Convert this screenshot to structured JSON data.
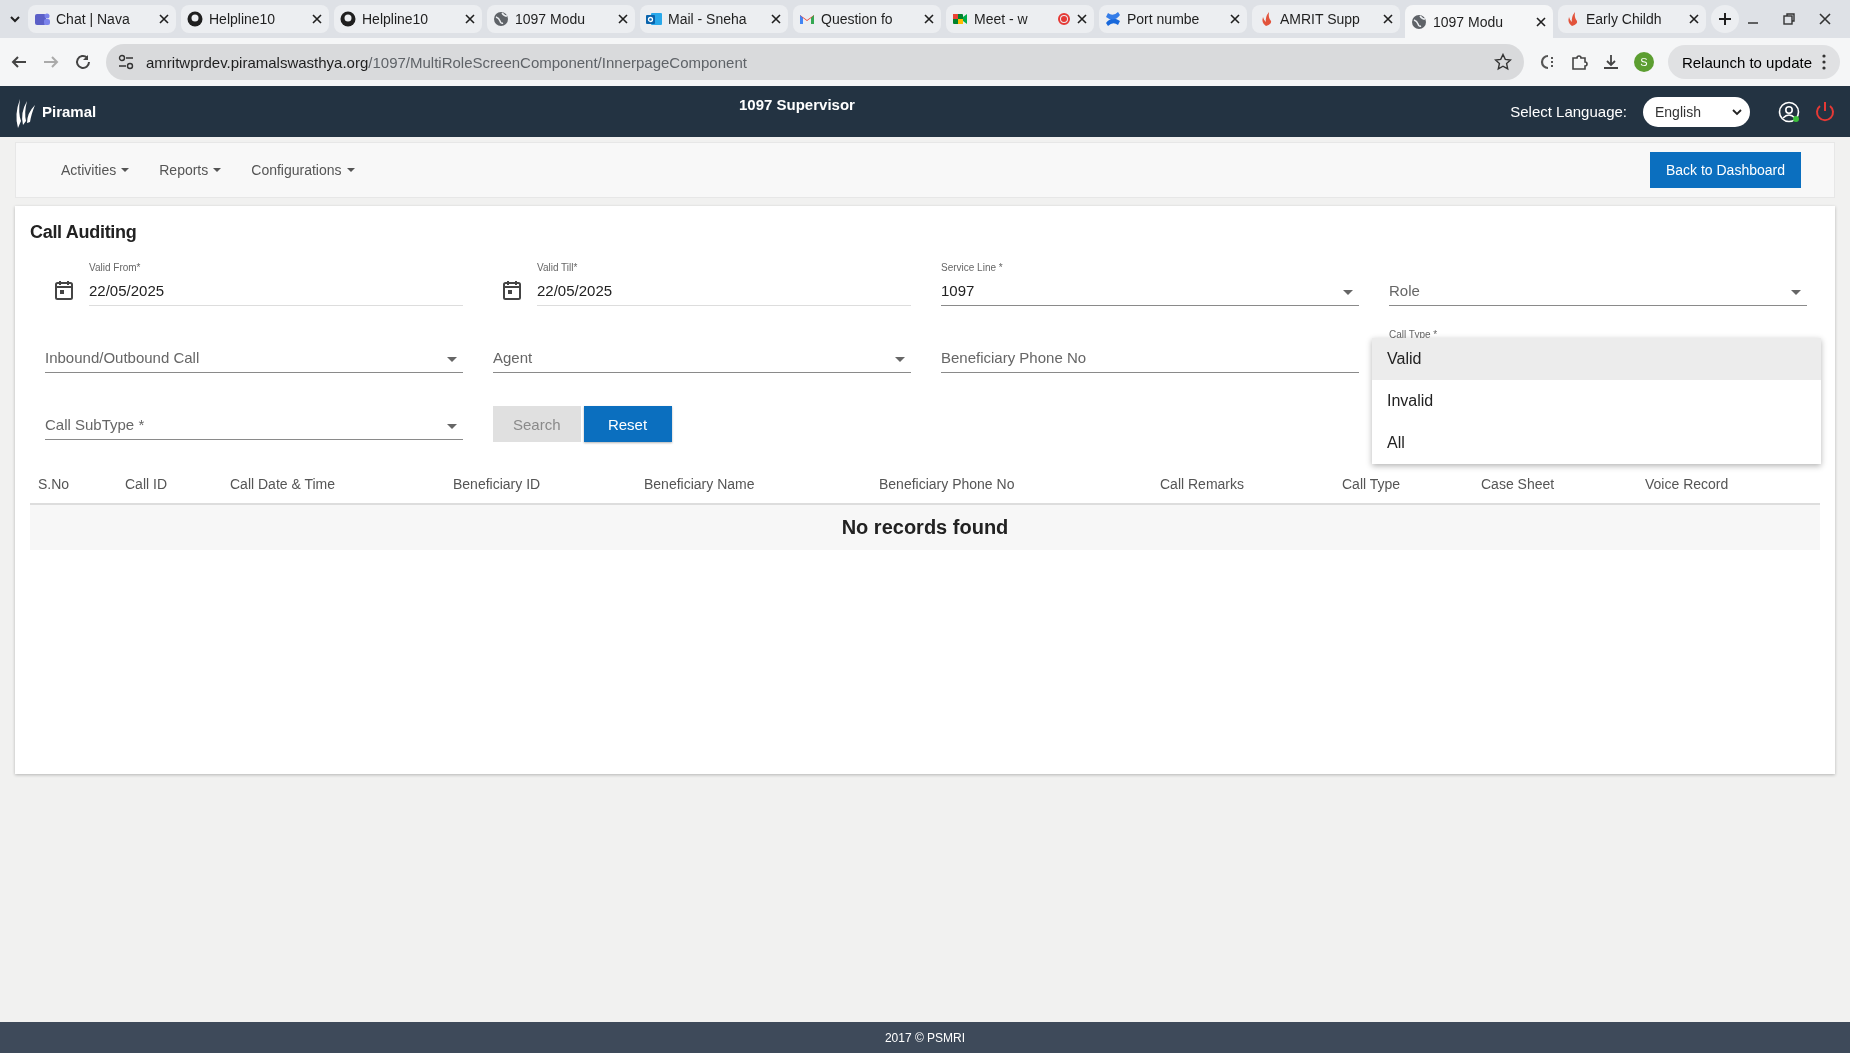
{
  "browser": {
    "tabs": [
      {
        "kind": "teams",
        "title": "Chat | Nava",
        "selected": false,
        "recording": false
      },
      {
        "kind": "github",
        "title": "Helpline10",
        "selected": false,
        "recording": false
      },
      {
        "kind": "github",
        "title": "Helpline10",
        "selected": false,
        "recording": false
      },
      {
        "kind": "globe",
        "title": "1097 Modu",
        "selected": false,
        "recording": false
      },
      {
        "kind": "outlook",
        "title": "Mail - Sneha",
        "selected": false,
        "recording": false
      },
      {
        "kind": "gmail",
        "title": "Question fo",
        "selected": false,
        "recording": false
      },
      {
        "kind": "meet",
        "title": "Meet - w",
        "selected": false,
        "recording": true
      },
      {
        "kind": "confluence",
        "title": "Port numbe",
        "selected": false,
        "recording": false
      },
      {
        "kind": "flame",
        "title": "AMRIT Supp",
        "selected": false,
        "recording": false
      },
      {
        "kind": "globe",
        "title": "1097 Modu",
        "selected": true,
        "recording": false
      },
      {
        "kind": "flame",
        "title": "Early Childh",
        "selected": false,
        "recording": false
      }
    ],
    "url_host": "amritwprdev.piramalswasthya.org",
    "url_path": "/1097/MultiRoleScreenComponent/InnerpageComponent",
    "profile_initial": "S",
    "relaunch": "Relaunch to update"
  },
  "header": {
    "brand": "Piramal",
    "title": "1097 Supervisor",
    "language_label": "Select Language:",
    "language": "English"
  },
  "nav": {
    "menus": [
      "Activities",
      "Reports",
      "Configurations"
    ],
    "back_button": "Back to Dashboard"
  },
  "card": {
    "title": "Call Auditing",
    "fields": [
      {
        "kind": "date",
        "label": "Valid From*",
        "value": "22/05/2025"
      },
      {
        "kind": "date",
        "label": "Valid Till*",
        "value": "22/05/2025"
      },
      {
        "kind": "select",
        "label": "Service Line *",
        "value": "1097"
      },
      {
        "kind": "select",
        "placeholder": "Role"
      },
      {
        "kind": "select",
        "placeholder": "Inbound/Outbound Call"
      },
      {
        "kind": "select",
        "placeholder": "Agent"
      },
      {
        "kind": "input",
        "placeholder": "Beneficiary Phone No"
      },
      {
        "kind": "select",
        "label": "Call Type *",
        "open": true,
        "options": [
          {
            "label": "Valid",
            "highlighted": true
          },
          {
            "label": "Invalid",
            "highlighted": false
          },
          {
            "label": "All",
            "highlighted": false
          }
        ]
      },
      {
        "kind": "select",
        "placeholder": "Call SubType *"
      }
    ],
    "buttons": [
      {
        "label": "Search",
        "disabled": true
      },
      {
        "label": "Reset",
        "disabled": false
      }
    ]
  },
  "table": {
    "columns": [
      "S.No",
      "Call ID",
      "Call Date & Time",
      "Beneficiary ID",
      "Beneficiary Name",
      "Beneficiary Phone No",
      "Call Remarks",
      "Call Type",
      "Case Sheet",
      "Voice Record"
    ],
    "empty_message": "No records found"
  },
  "footer": "2017 © PSMRI"
}
